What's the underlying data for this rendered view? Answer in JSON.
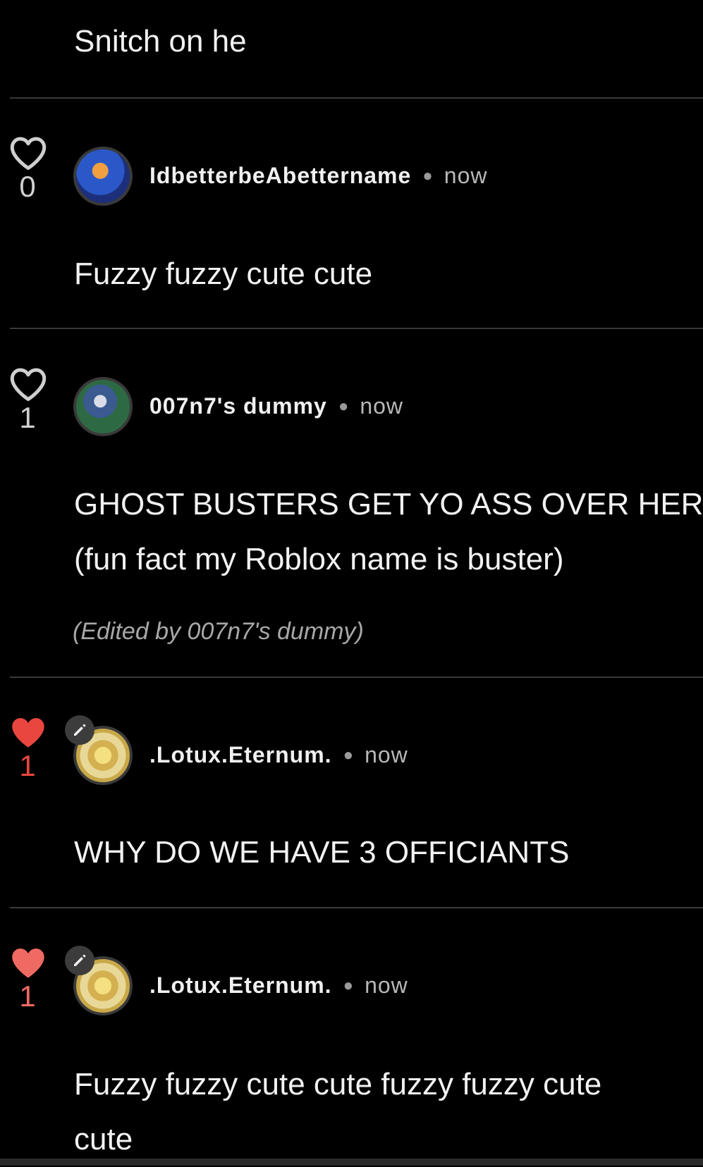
{
  "top_comment": {
    "body": "Snitch on he"
  },
  "comments": [
    {
      "like_count": "0",
      "liked": false,
      "username": "IdbetterbeAbettername",
      "time": "now",
      "body_lines": [
        "Fuzzy fuzzy cute cute"
      ]
    },
    {
      "like_count": "1",
      "liked": false,
      "username": "007n7's dummy",
      "time": "now",
      "body_lines": [
        "GHOST BUSTERS GET YO ASS OVER HERE",
        "(fun fact my Roblox name is buster)"
      ],
      "edited_note": "(Edited by 007n7's dummy)"
    },
    {
      "like_count": "1",
      "liked": true,
      "username": ".Lotux.Eternum.",
      "time": "now",
      "body_lines": [
        "WHY DO WE HAVE 3 OFFICIANTS"
      ]
    },
    {
      "like_count": "1",
      "liked": true,
      "username": ".Lotux.Eternum.",
      "time": "now",
      "body_lines": [
        "Fuzzy fuzzy cute cute fuzzy fuzzy cute",
        "cute"
      ]
    }
  ],
  "colors": {
    "liked_heart": "#e8463e",
    "liked_heart_light": "#ef6a63",
    "divider": "#3a3a3a",
    "background": "#000000"
  },
  "icons": [
    "heart-outline-icon",
    "heart-filled-icon",
    "pencil-icon"
  ]
}
